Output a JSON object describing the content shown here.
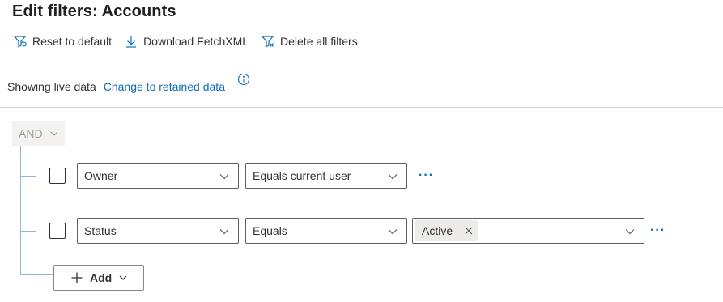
{
  "header": {
    "title": "Edit filters: Accounts"
  },
  "toolbar": {
    "reset_label": "Reset to default",
    "download_label": "Download FetchXML",
    "delete_label": "Delete all filters"
  },
  "data_source": {
    "showing_text": "Showing live data",
    "change_link": "Change to retained data"
  },
  "group": {
    "operator": "AND"
  },
  "conditions": [
    {
      "field": "Owner",
      "operator": "Equals current user",
      "values": []
    },
    {
      "field": "Status",
      "operator": "Equals",
      "values": [
        "Active"
      ]
    }
  ],
  "add_button": {
    "label": "Add"
  },
  "more_label": "···",
  "colors": {
    "accent": "#0f6cbd",
    "tree_line": "#8fb8e0",
    "text": "#323130"
  }
}
